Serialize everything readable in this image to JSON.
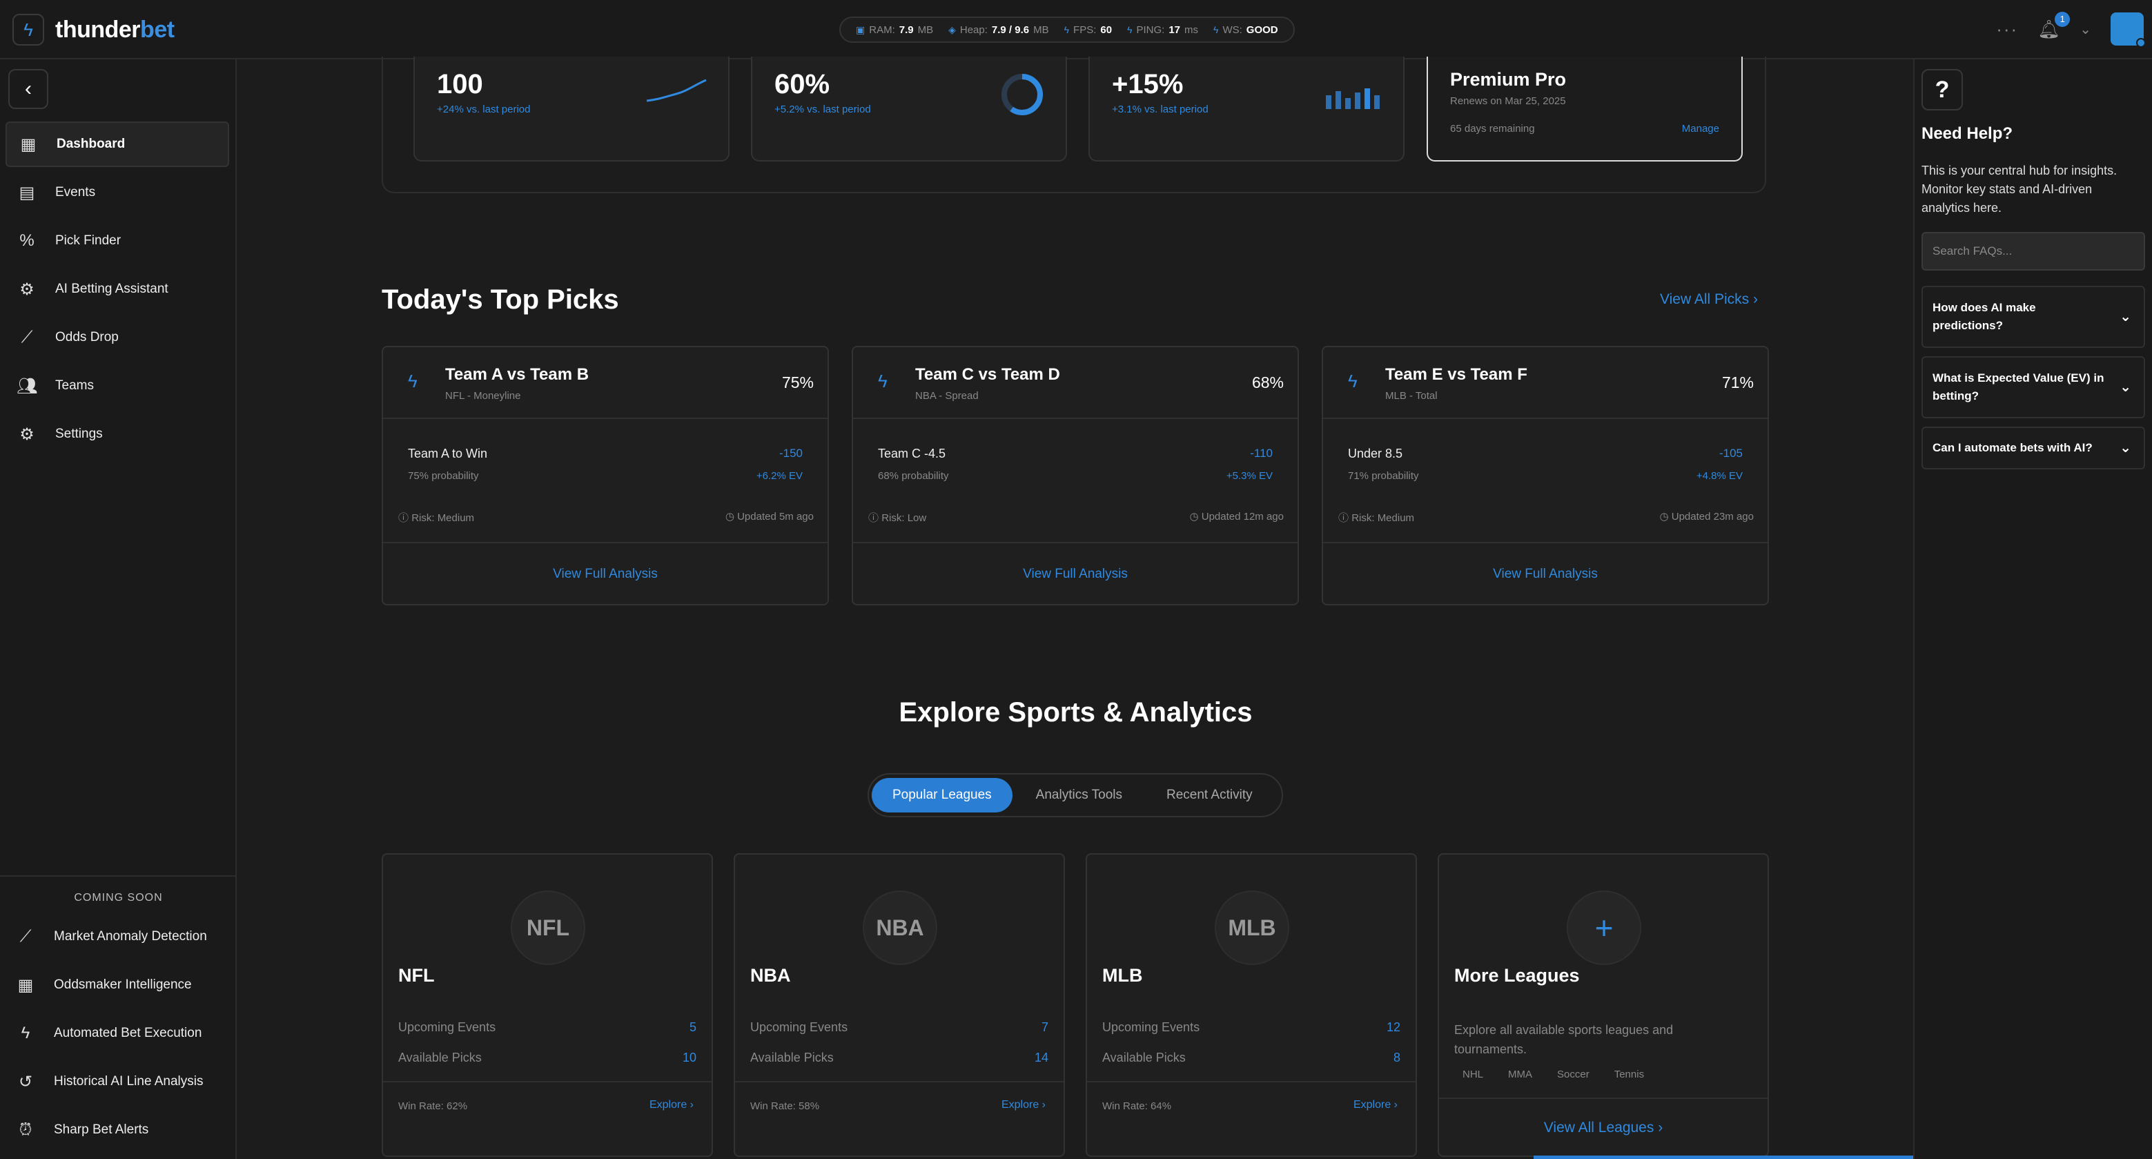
{
  "app": {
    "brand_part1": "thunder",
    "brand_part2": "bet"
  },
  "stats": [
    {
      "label": "RAM:",
      "value": "7.9",
      "unit": "MB"
    },
    {
      "label": "Heap:",
      "value": "7.9 / 9.6",
      "unit": "MB"
    },
    {
      "label": "FPS:",
      "value": "60",
      "unit": ""
    },
    {
      "label": "PING:",
      "value": "17",
      "unit": "ms"
    },
    {
      "label": "WS:",
      "value": "GOOD",
      "unit": ""
    }
  ],
  "notifications": {
    "count": "1"
  },
  "sidebar": {
    "items": [
      {
        "label": "Dashboard",
        "icon": "dashboard-icon"
      },
      {
        "label": "Events",
        "icon": "calendar-icon"
      },
      {
        "label": "Pick Finder",
        "icon": "percent-icon"
      },
      {
        "label": "AI Betting Assistant",
        "icon": "ai-chip-icon"
      },
      {
        "label": "Odds Drop",
        "icon": "trend-icon"
      },
      {
        "label": "Teams",
        "icon": "teams-icon"
      },
      {
        "label": "Settings",
        "icon": "gear-icon"
      }
    ],
    "coming_soon_title": "COMING SOON",
    "coming_soon": [
      {
        "label": "Market Anomaly Detection",
        "icon": "anomaly-icon"
      },
      {
        "label": "Oddsmaker Intelligence",
        "icon": "grid-icon"
      },
      {
        "label": "Automated Bet Execution",
        "icon": "lightning-icon"
      },
      {
        "label": "Historical AI Line Analysis",
        "icon": "history-icon"
      },
      {
        "label": "Sharp Bet Alerts",
        "icon": "alarm-icon"
      }
    ]
  },
  "stat_cards": [
    {
      "value": "100",
      "sub": "+24% vs. last period"
    },
    {
      "value": "60%",
      "sub": "+5.2% vs. last period"
    },
    {
      "value": "+15%",
      "sub": "+3.1% vs. last period"
    }
  ],
  "premium": {
    "title": "Premium Pro",
    "renews": "Renews on Mar 25, 2025",
    "remaining": "65 days remaining",
    "manage": "Manage"
  },
  "top_picks": {
    "title": "Today's Top Picks",
    "view_all": "View All Picks",
    "picks": [
      {
        "teams": "Team A vs Team B",
        "league": "NFL - Moneyline",
        "pct": "75%",
        "selection": "Team A to Win",
        "odds": "-150",
        "prob": "75% probability",
        "ev": "+6.2% EV",
        "risk": "Risk: Medium",
        "updated": "Updated 5m ago",
        "cta": "View Full Analysis"
      },
      {
        "teams": "Team C vs Team D",
        "league": "NBA - Spread",
        "pct": "68%",
        "selection": "Team C -4.5",
        "odds": "-110",
        "prob": "68% probability",
        "ev": "+5.3% EV",
        "risk": "Risk: Low",
        "updated": "Updated 12m ago",
        "cta": "View Full Analysis"
      },
      {
        "teams": "Team E vs Team F",
        "league": "MLB - Total",
        "pct": "71%",
        "selection": "Under 8.5",
        "odds": "-105",
        "prob": "71% probability",
        "ev": "+4.8% EV",
        "risk": "Risk: Medium",
        "updated": "Updated 23m ago",
        "cta": "View Full Analysis"
      }
    ]
  },
  "explore": {
    "title": "Explore Sports & Analytics",
    "tabs": [
      "Popular Leagues",
      "Analytics Tools",
      "Recent Activity"
    ],
    "leagues": [
      {
        "abbr": "NFL",
        "name": "NFL",
        "upcoming_label": "Upcoming Events",
        "upcoming": "5",
        "picks_label": "Available Picks",
        "picks": "10",
        "win_rate": "Win Rate: 62%",
        "explore": "Explore"
      },
      {
        "abbr": "NBA",
        "name": "NBA",
        "upcoming_label": "Upcoming Events",
        "upcoming": "7",
        "picks_label": "Available Picks",
        "picks": "14",
        "win_rate": "Win Rate: 58%",
        "explore": "Explore"
      },
      {
        "abbr": "MLB",
        "name": "MLB",
        "upcoming_label": "Upcoming Events",
        "upcoming": "12",
        "picks_label": "Available Picks",
        "picks": "8",
        "win_rate": "Win Rate: 64%",
        "explore": "Explore"
      }
    ],
    "more": {
      "name": "More Leagues",
      "desc": "Explore all available sports leagues and tournaments.",
      "tags": [
        "NHL",
        "MMA",
        "Soccer",
        "Tennis"
      ],
      "cta": "View All Leagues"
    }
  },
  "help": {
    "title": "Need Help?",
    "text": "This is your central hub for insights. Monitor key stats and AI-driven analytics here.",
    "search_placeholder": "Search FAQs...",
    "faqs": [
      "How does AI make predictions?",
      "What is Expected Value (EV) in betting?",
      "Can I automate bets with AI?"
    ]
  },
  "colors": {
    "accent": "#2f8ae0",
    "background": "#1c1c1c"
  }
}
